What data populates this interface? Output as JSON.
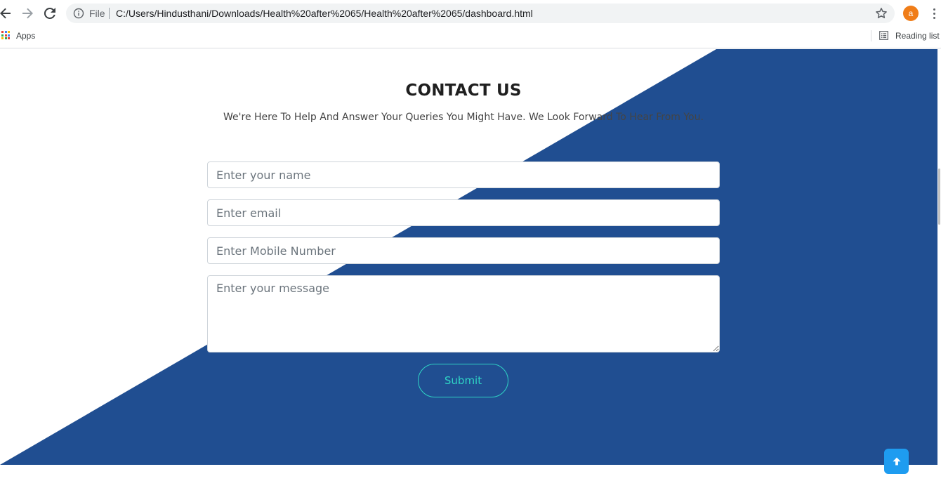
{
  "browser": {
    "file_label": "File",
    "url": "C:/Users/Hindusthani/Downloads/Health%20after%2065/Health%20after%2065/dashboard.html",
    "profile_initial": "a",
    "profile_color": "#f07d18",
    "bookmarks": {
      "apps_label": "Apps",
      "reading_list_label": "Reading list"
    }
  },
  "contact": {
    "title": "CONTACT US",
    "subtitle": "We're Here To Help And Answer Your Queries You Might Have. We Look Forward To Hear From You.",
    "form": {
      "name_placeholder": "Enter your name",
      "email_placeholder": "Enter email",
      "mobile_placeholder": "Enter Mobile Number",
      "message_placeholder": "Enter your message",
      "submit_label": "Submit"
    }
  },
  "colors": {
    "background_shape": "#204e91",
    "submit_accent": "#2fd4c5",
    "scroll_top_button": "#1e9cf0"
  },
  "icons": {
    "back": "arrow-left-icon",
    "forward": "arrow-right-icon",
    "reload": "reload-icon",
    "info": "info-icon",
    "bookmark": "star-icon",
    "menu": "more-vert-icon",
    "apps": "apps-grid-icon",
    "reading_list": "reading-list-icon",
    "scroll_top": "arrow-up-icon"
  }
}
